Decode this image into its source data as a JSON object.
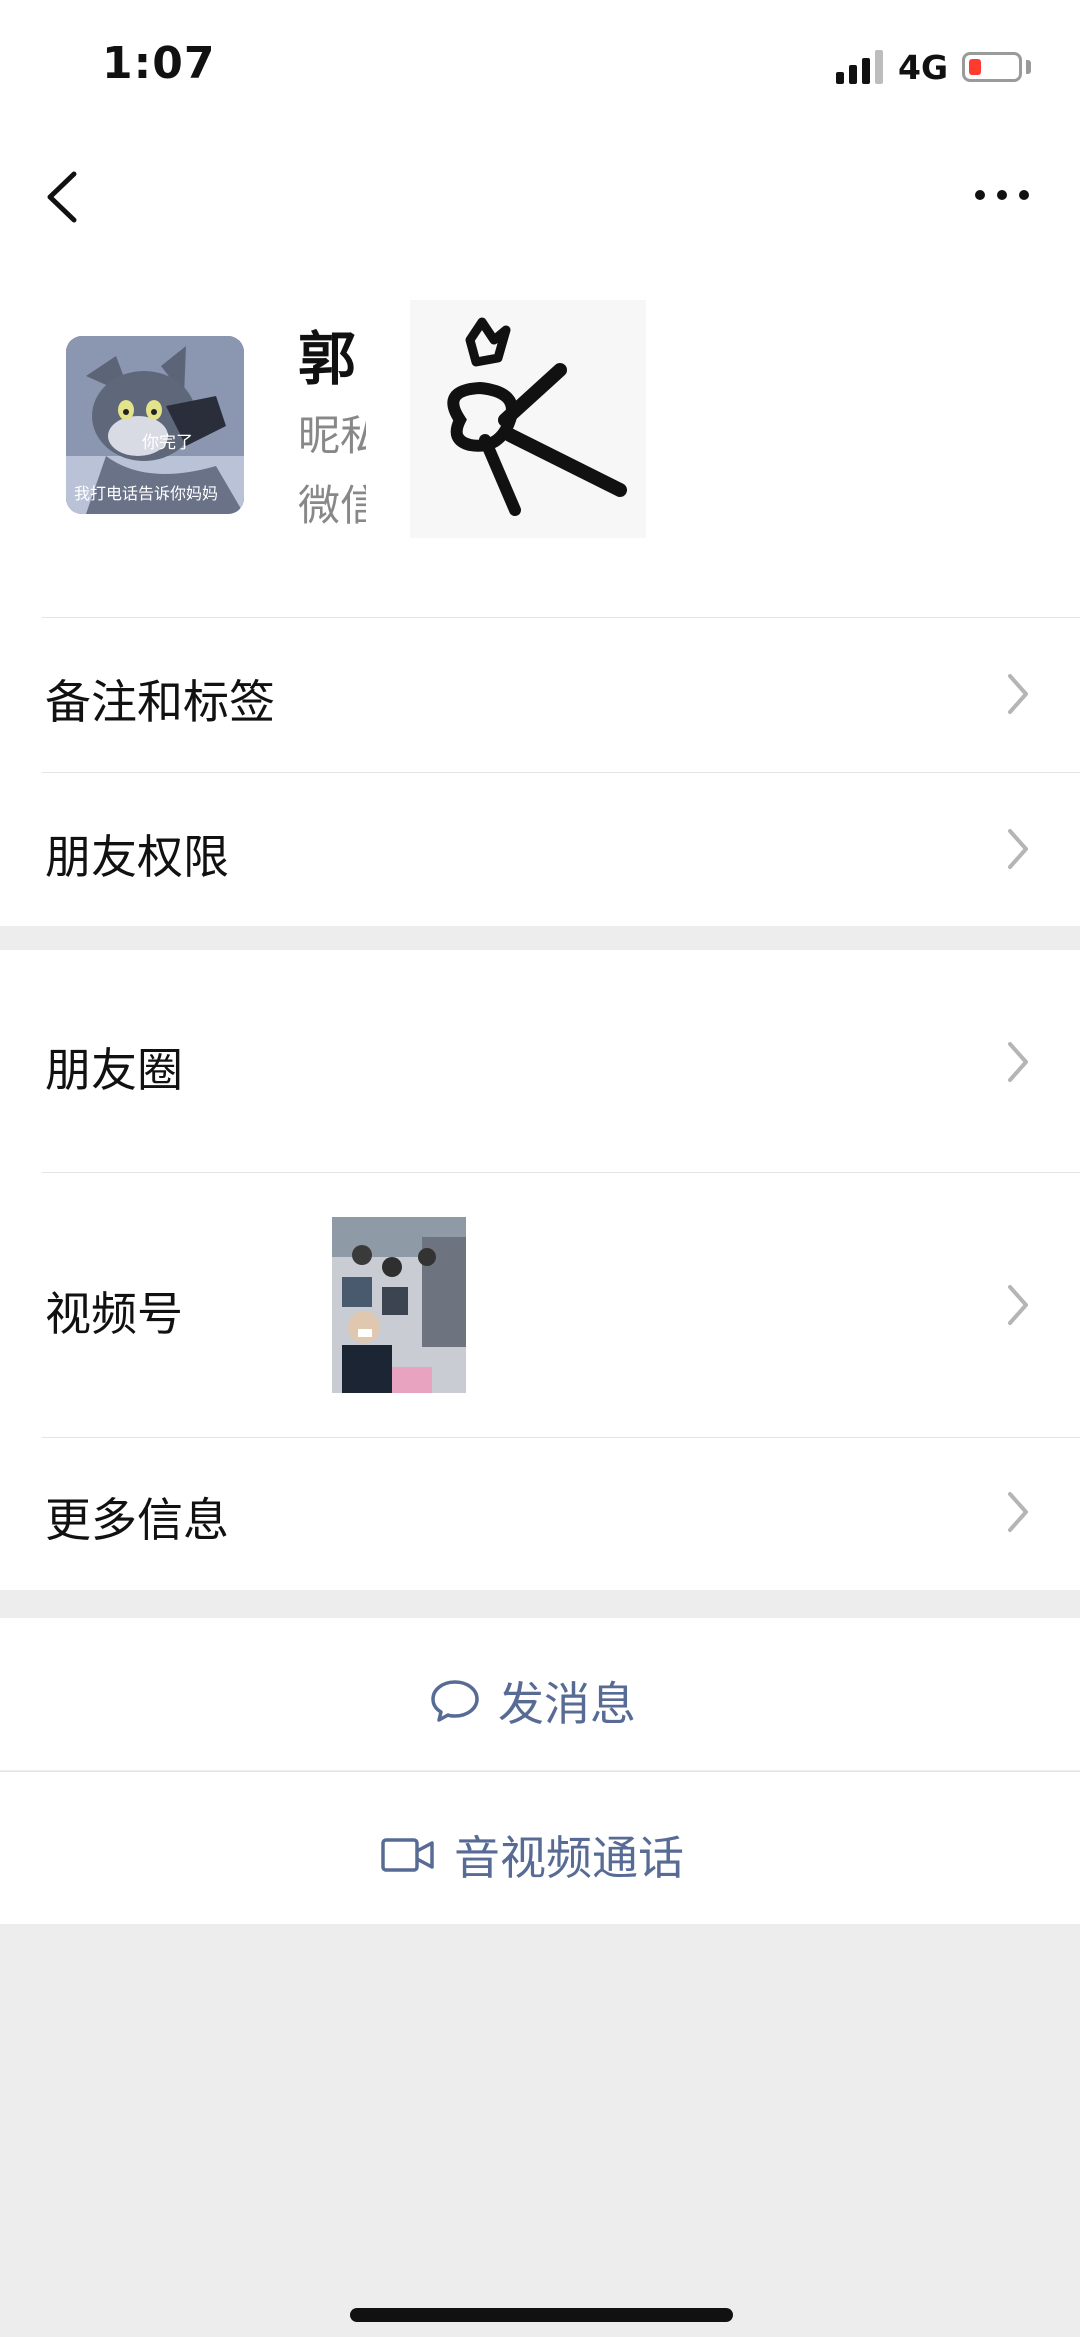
{
  "status_bar": {
    "time": "1:07",
    "network": "4G",
    "signal_bars": 3,
    "battery_level": 0.15
  },
  "nav": {
    "back_icon": "chevron-left-icon",
    "more_icon": "ellipsis-icon"
  },
  "profile": {
    "name": "郭",
    "nickname_label": "昵私",
    "wechat_id_label": "微信",
    "avatar_caption_top": "你完了",
    "avatar_caption_bottom": "我打电话告诉你妈妈"
  },
  "menu": {
    "remarks_tags": "备注和标签",
    "friend_permissions": "朋友权限",
    "moments": "朋友圈",
    "channels": "视频号",
    "more_info": "更多信息"
  },
  "actions": {
    "send_message": "发消息",
    "video_call": "音视频通话"
  },
  "colors": {
    "background": "#ededed",
    "link": "#576b95",
    "battery_low": "#ff3b30"
  }
}
